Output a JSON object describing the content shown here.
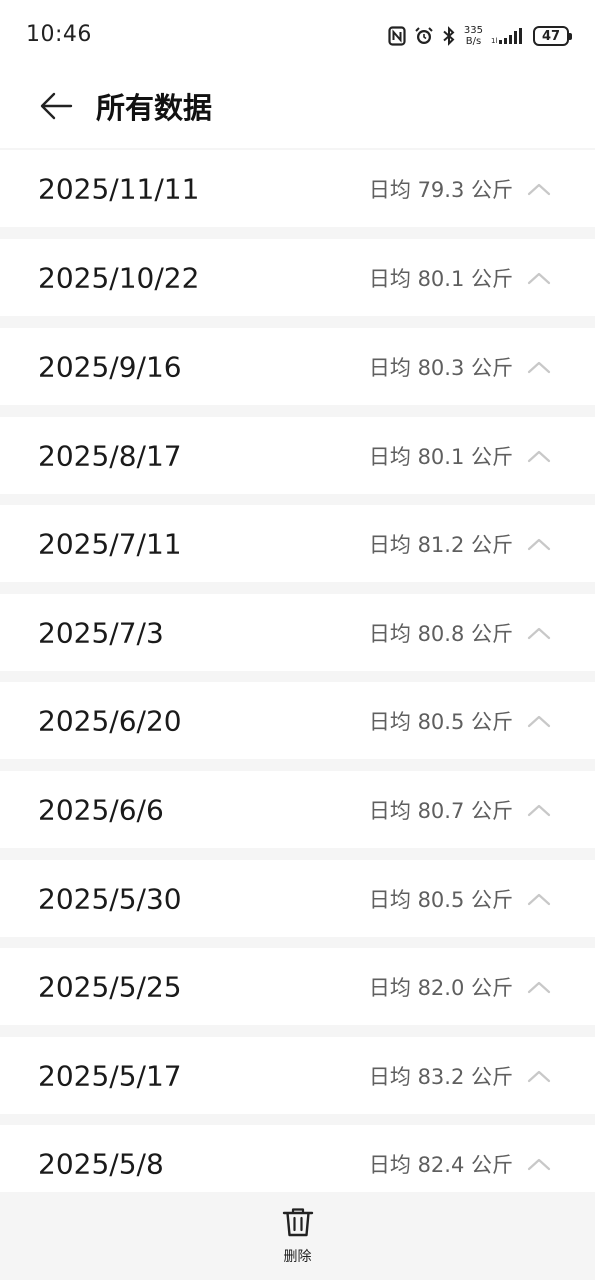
{
  "status_bar": {
    "time": "10:46",
    "net_speed_value": "335",
    "net_speed_unit": "B/s",
    "battery": "47",
    "icons": [
      "nfc-icon",
      "alarm-icon",
      "bluetooth-icon",
      "signal-icon",
      "battery-icon"
    ]
  },
  "header": {
    "back_icon": "arrow-left-icon",
    "title": "所有数据"
  },
  "records": [
    {
      "date": "2025/11/11",
      "avg": "日均 79.3 公斤"
    },
    {
      "date": "2025/10/22",
      "avg": "日均 80.1 公斤"
    },
    {
      "date": "2025/9/16",
      "avg": "日均 80.3 公斤"
    },
    {
      "date": "2025/8/17",
      "avg": "日均 80.1 公斤"
    },
    {
      "date": "2025/7/11",
      "avg": "日均 81.2 公斤"
    },
    {
      "date": "2025/7/3",
      "avg": "日均 80.8 公斤"
    },
    {
      "date": "2025/6/20",
      "avg": "日均 80.5 公斤"
    },
    {
      "date": "2025/6/6",
      "avg": "日均 80.7 公斤"
    },
    {
      "date": "2025/5/30",
      "avg": "日均 80.5 公斤"
    },
    {
      "date": "2025/5/25",
      "avg": "日均 82.0 公斤"
    },
    {
      "date": "2025/5/17",
      "avg": "日均 83.2 公斤"
    },
    {
      "date": "2025/5/8",
      "avg": "日均 82.4 公斤"
    }
  ],
  "bottom_bar": {
    "delete_icon": "trash-icon",
    "delete_label": "删除"
  },
  "colors": {
    "background": "#f5f5f5",
    "row_background": "#ffffff",
    "primary_text": "#1a1a1a",
    "secondary_text": "#5f5f5f",
    "chevron": "#c8c8c8"
  }
}
